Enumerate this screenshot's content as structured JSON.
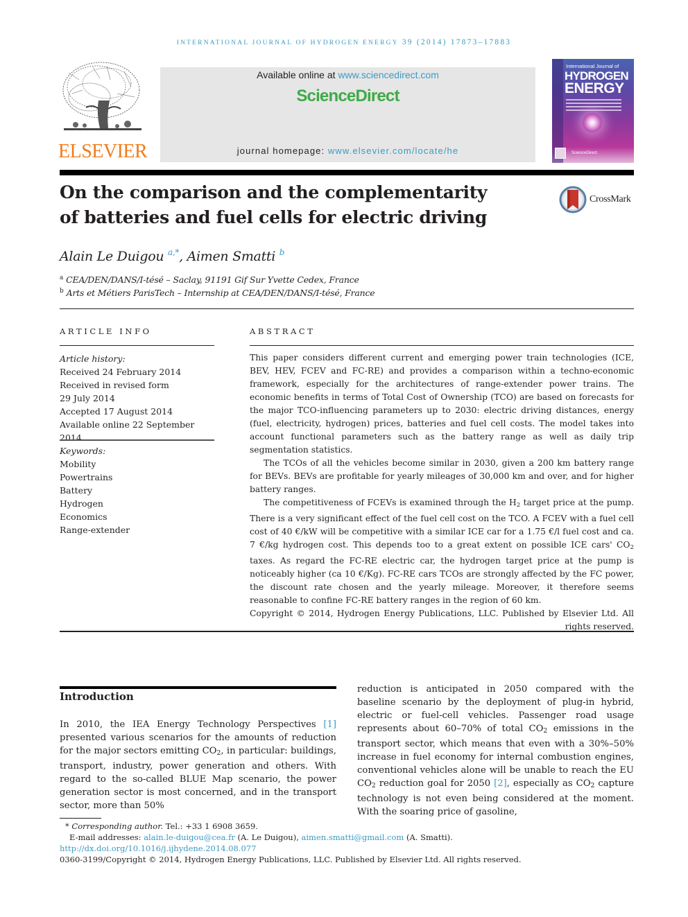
{
  "running_header": {
    "journal": "International Journal of Hydrogen Energy",
    "volume": "39",
    "year": "(2014)",
    "pages": "17873–17883"
  },
  "masthead": {
    "publisher_logo": "ELSEVIER",
    "available_prefix": "Available online at ",
    "available_link": "www.sciencedirect.com",
    "brand": "ScienceDirect",
    "homepage_prefix": "journal homepage: ",
    "homepage_link": "www.elsevier.com/locate/he",
    "cover": {
      "line1": "International Journal of",
      "line2": "HYDROGEN",
      "line3": "ENERGY",
      "footer": "ScienceDirect"
    },
    "colors": {
      "link": "#3a9bc2",
      "sciencedirect_green": "#3eaa47",
      "elsevier_orange": "#f07c1a"
    }
  },
  "article": {
    "title_line1": "On the comparison and the complementarity",
    "title_line2": "of batteries and fuel cells for electric driving",
    "crossmark_label": "CrossMark",
    "authors": [
      {
        "name": "Alain Le Duigou",
        "sup": "a,*"
      },
      {
        "name": "Aimen Smatti",
        "sup": "b"
      }
    ],
    "author_separator": ", ",
    "affiliations": [
      {
        "label": "a",
        "text": "CEA/DEN/DANS/I-tésé – Saclay, 91191 Gif Sur Yvette Cedex, France"
      },
      {
        "label": "b",
        "text": "Arts et Métiers ParisTech – Internship at CEA/DEN/DANS/I-tésé, France"
      }
    ]
  },
  "article_info": {
    "heading": "ARTICLE INFO",
    "history_label": "Article history:",
    "history": [
      "Received 24 February 2014",
      "Received in revised form",
      "29 July 2014",
      "Accepted 17 August 2014",
      "Available online 22 September 2014"
    ],
    "keywords_label": "Keywords:",
    "keywords": [
      "Mobility",
      "Powertrains",
      "Battery",
      "Hydrogen",
      "Economics",
      "Range-extender"
    ]
  },
  "abstract": {
    "heading": "ABSTRACT",
    "p1": "This paper considers different current and emerging power train technologies (ICE, BEV, HEV, FCEV and FC-RE) and provides a comparison within a techno-economic framework, especially for the architectures of range-extender power trains. The economic benefits in terms of Total Cost of Ownership (TCO) are based on forecasts for the major TCO-influencing parameters up to 2030: electric driving distances, energy (fuel, electricity, hydrogen) prices, batteries and fuel cell costs. The model takes into account functional parameters such as the battery range as well as daily trip segmentation statistics.",
    "p2": "The TCOs of all the vehicles become similar in 2030, given a 200 km battery range for BEVs. BEVs are profitable for yearly mileages of 30,000 km and over, and for higher battery ranges.",
    "p3_a": "The competitiveness of FCEVs is examined through the H",
    "p3_sub1": "2",
    "p3_b": " target price at the pump. There is a very significant effect of the fuel cell cost on the TCO. A FCEV with a fuel cell cost of 40 €/kW will be competitive with a similar ICE car for a 1.75 €/l fuel cost and ca. 7 €/kg hydrogen cost. This depends too to a great extent on possible ICE cars' CO",
    "p3_sub2": "2",
    "p3_c": " taxes. As regard the FC-RE electric car, the hydrogen target price at the pump is noticeably higher (ca 10 €/Kg). FC-RE cars TCOs are strongly affected by the FC power, the discount rate chosen and the yearly mileage. Moreover, it therefore seems reasonable to confine FC-RE battery ranges in the region of 60 km.",
    "copyright": "Copyright © 2014, Hydrogen Energy Publications, LLC. Published by Elsevier Ltd. All rights reserved."
  },
  "body": {
    "intro_heading": "Introduction",
    "left": {
      "t1": "In 2010, the IEA Energy Technology Perspectives ",
      "cite1": "[1]",
      "t2": " presented various scenarios for the amounts of reduction for the major sectors emitting CO",
      "sub1": "2",
      "t3": ", in particular: buildings, transport, industry, power generation and others. With regard to the so-called BLUE Map scenario, the power generation sector is most concerned, and in the transport sector, more than 50%"
    },
    "right": {
      "t1": "reduction is anticipated in 2050 compared with the baseline scenario by the deployment of plug-in hybrid, electric or fuel-cell vehicles. Passenger road usage represents about 60–70% of total CO",
      "sub1": "2",
      "t2": " emissions in the transport sector, which means that even with a 30%–50% increase in fuel economy for internal combustion engines, conventional vehicles alone will be unable to reach the EU CO",
      "sub2": "2",
      "t3": " reduction goal for 2050 ",
      "cite2": "[2]",
      "t4": ", especially as CO",
      "sub3": "2",
      "t5": " capture technology is not even being considered at the moment. With the soaring price of gasoline,"
    }
  },
  "footnotes": {
    "star": "*",
    "corresponding_label": "Corresponding author.",
    "tel": " Tel.: +33 1 6908 3659.",
    "email_label": "E-mail addresses: ",
    "email1": "alain.le-duigou@cea.fr",
    "email1_who": " (A. Le Duigou), ",
    "email2": "aimen.smatti@gmail.com",
    "email2_who": " (A. Smatti).",
    "doi": "http://dx.doi.org/10.1016/j.ijhydene.2014.08.077",
    "issn_copyright": "0360-3199/Copyright © 2014, Hydrogen Energy Publications, LLC. Published by Elsevier Ltd. All rights reserved."
  }
}
